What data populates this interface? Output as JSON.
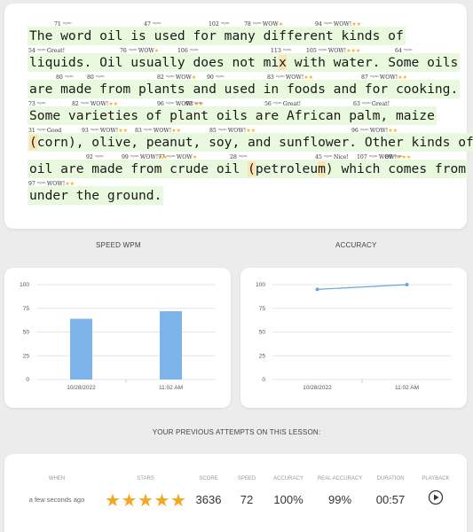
{
  "passage": {
    "lines": [
      "The word oil is used for many different kinds of",
      "liquids. Oil usually does not mix with water. Some oils",
      "are made from plants and used in foods and for cooking.",
      "Some varieties of plant oils are African palm, maize",
      "(corn), olive, peanut, soy, and sunflower. Other kinds of",
      "oil are made from crude oil (petroleum) which comes from",
      "under the ground."
    ],
    "wpm_unit": "wpm",
    "annotations": [
      {
        "wpm": "71",
        "label": "",
        "stars": ""
      },
      {
        "wpm": "47",
        "label": "",
        "stars": ""
      },
      {
        "wpm": "102",
        "label": "",
        "stars": ""
      },
      {
        "wpm": "78",
        "label": "WOW",
        "stars": "★"
      },
      {
        "wpm": "94",
        "label": "WOW!",
        "stars": "★★"
      },
      {
        "wpm": "54",
        "label": "Great!",
        "stars": ""
      },
      {
        "wpm": "76",
        "label": "WOW",
        "stars": "★"
      },
      {
        "wpm": "106",
        "label": "",
        "stars": ""
      },
      {
        "wpm": "113",
        "label": "",
        "stars": ""
      },
      {
        "wpm": "105",
        "label": "WOW!",
        "stars": "★★★"
      },
      {
        "wpm": "64",
        "label": "",
        "stars": ""
      },
      {
        "wpm": "80",
        "label": "",
        "stars": ""
      },
      {
        "wpm": "80",
        "label": "",
        "stars": ""
      },
      {
        "wpm": "82",
        "label": "WOW",
        "stars": "★"
      },
      {
        "wpm": "90",
        "label": "",
        "stars": ""
      },
      {
        "wpm": "83",
        "label": "WOW!",
        "stars": "★★"
      },
      {
        "wpm": "87",
        "label": "WOW!",
        "stars": "★★"
      },
      {
        "wpm": "73",
        "label": "",
        "stars": ""
      },
      {
        "wpm": "82",
        "label": "WOW!",
        "stars": "★★"
      },
      {
        "wpm": "96",
        "label": "WOW!",
        "stars": "★★"
      },
      {
        "wpm": "93",
        "label": "",
        "stars": ""
      },
      {
        "wpm": "56",
        "label": "Great!",
        "stars": ""
      },
      {
        "wpm": "63",
        "label": "Great!",
        "stars": ""
      },
      {
        "wpm": "31",
        "label": "Good",
        "stars": ""
      },
      {
        "wpm": "93",
        "label": "WOW!",
        "stars": "★★"
      },
      {
        "wpm": "83",
        "label": "WOW!",
        "stars": "★★"
      },
      {
        "wpm": "85",
        "label": "WOW!",
        "stars": "★★"
      },
      {
        "wpm": "96",
        "label": "WOW!",
        "stars": "★★"
      },
      {
        "wpm": "92",
        "label": "",
        "stars": ""
      },
      {
        "wpm": "99",
        "label": "WOW!",
        "stars": "★★"
      },
      {
        "wpm": "77",
        "label": "WOW",
        "stars": "★"
      },
      {
        "wpm": "28",
        "label": "",
        "stars": ""
      },
      {
        "wpm": "45",
        "label": "Nice!",
        "stars": ""
      },
      {
        "wpm": "107",
        "label": "WOW!",
        "stars": "★★★"
      },
      {
        "wpm": "89",
        "label": "",
        "stars": ""
      },
      {
        "wpm": "97",
        "label": "WOW!",
        "stars": "★★"
      }
    ]
  },
  "chart_data": [
    {
      "type": "bar",
      "title": "SPEED WPM",
      "categories": [
        "10/28/2022",
        "11:02 AM"
      ],
      "values": [
        64,
        72
      ],
      "ylim": [
        0,
        100
      ],
      "yticks": [
        0,
        25,
        50,
        75,
        100
      ],
      "color": "#7db5ea",
      "grid": true
    },
    {
      "type": "line",
      "title": "ACCURACY",
      "categories": [
        "10/28/2022",
        "11:02 AM"
      ],
      "values": [
        95,
        100
      ],
      "ylim": [
        0,
        100
      ],
      "yticks": [
        0,
        25,
        50,
        75,
        100
      ],
      "color": "#6aa6dd",
      "grid": true
    }
  ],
  "attempts": {
    "title": "YOUR PREVIOUS ATTEMPTS ON THIS LESSON:",
    "headers": [
      "WHEN",
      "STARS",
      "SCORE",
      "SPEED",
      "ACCURACY",
      "REAL ACCURACY",
      "DURATION",
      "PLAYBACK"
    ],
    "rows": [
      {
        "when": "a few seconds ago",
        "stars": 5,
        "score": "3636",
        "speed": "72",
        "accuracy": "100%",
        "real_accuracy": "99%",
        "duration": "00:57"
      }
    ]
  },
  "colors": {
    "highlight": "#e9f9dd",
    "error": "#fbe3b4",
    "star": "#f5a623"
  }
}
